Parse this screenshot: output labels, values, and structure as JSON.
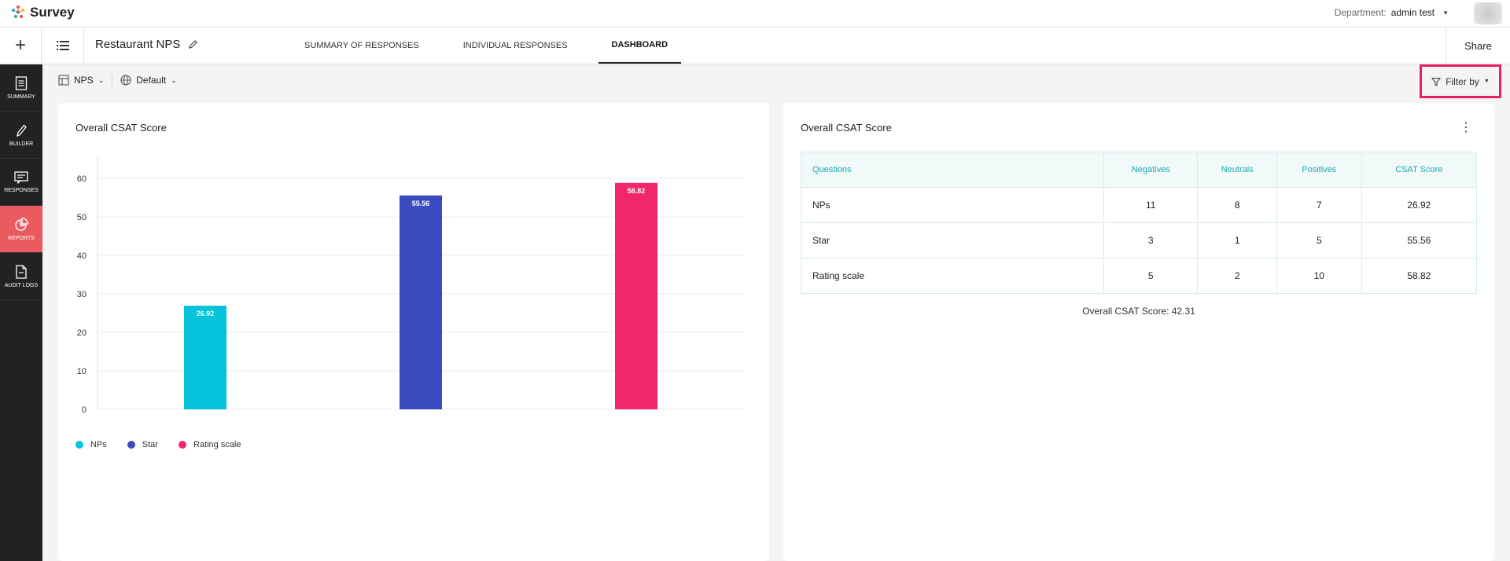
{
  "app": {
    "name": "Survey"
  },
  "header": {
    "department_label": "Department:",
    "department_value": "admin test"
  },
  "subbar": {
    "survey_title": "Restaurant NPS",
    "tabs": [
      {
        "label": "SUMMARY OF RESPONSES",
        "active": false
      },
      {
        "label": "INDIVIDUAL RESPONSES",
        "active": false
      },
      {
        "label": "DASHBOARD",
        "active": true
      }
    ],
    "share_label": "Share"
  },
  "sidebar": {
    "items": [
      {
        "label": "SUMMARY",
        "icon": "document-icon",
        "active": false
      },
      {
        "label": "BUILDER",
        "icon": "pencil-icon",
        "active": false
      },
      {
        "label": "RESPONSES",
        "icon": "responses-icon",
        "active": false
      },
      {
        "label": "REPORTS",
        "icon": "pie-chart-icon",
        "active": true
      },
      {
        "label": "AUDIT LOGS",
        "icon": "file-icon",
        "active": false
      }
    ]
  },
  "toolbar": {
    "report_label": "NPS",
    "view_label": "Default",
    "filter_label": "Filter by"
  },
  "left_card": {
    "title": "Overall CSAT Score"
  },
  "chart_data": {
    "type": "bar",
    "title": "Overall CSAT Score",
    "categories": [
      "NPs",
      "Star",
      "Rating scale"
    ],
    "values": [
      26.92,
      55.56,
      58.82
    ],
    "colors": [
      "#05c3db",
      "#3b4cc0",
      "#f0286a"
    ],
    "ylim": [
      0,
      60
    ],
    "yticks": [
      0,
      10,
      20,
      30,
      40,
      50,
      60
    ],
    "grid": true,
    "legend": "bottom-left"
  },
  "right_card": {
    "title": "Overall CSAT Score",
    "table": {
      "headers": [
        "Questions",
        "Negatives",
        "Neutrals",
        "Positives",
        "CSAT Score"
      ],
      "rows": [
        [
          "NPs",
          "11",
          "8",
          "7",
          "26.92"
        ],
        [
          "Star",
          "3",
          "1",
          "5",
          "55.56"
        ],
        [
          "Rating scale",
          "5",
          "2",
          "10",
          "58.82"
        ]
      ]
    },
    "overall_text": "Overall CSAT Score: 42.31"
  },
  "colors": {
    "accent_red": "#ea5a5f",
    "filter_highlight": "#e8205f",
    "teal": "#19a8b3"
  }
}
